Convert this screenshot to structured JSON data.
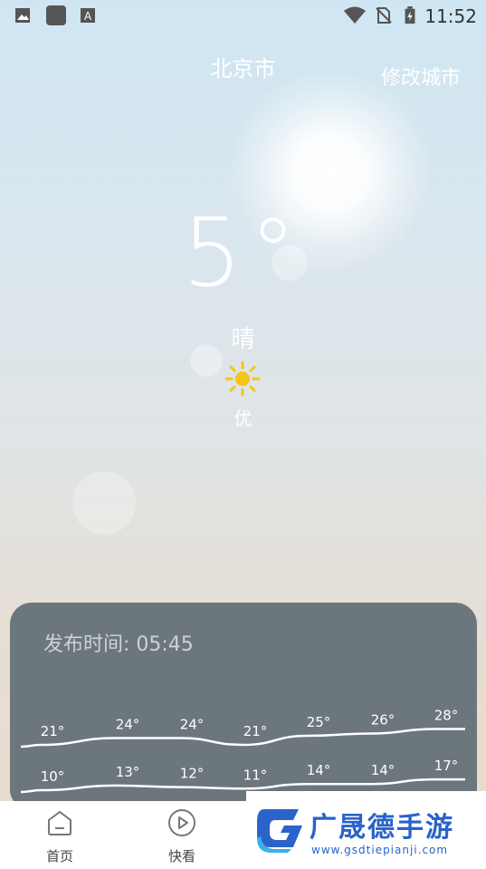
{
  "status_bar": {
    "time": "11:52",
    "icons": [
      "gallery-notification-icon",
      "app-notification-icon",
      "font-notification-icon",
      "wifi-icon",
      "no-sim-icon",
      "battery-charging-icon"
    ]
  },
  "header": {
    "city": "北京市",
    "change_city_label": "修改城市"
  },
  "current": {
    "temperature": "5°",
    "condition": "晴",
    "condition_icon": "sun-icon",
    "air_quality": "优"
  },
  "forecast": {
    "publish_time": "发布时间: 05:45",
    "chart_data": {
      "type": "line",
      "series": [
        {
          "values": [
            21,
            24,
            24,
            21,
            25,
            26,
            28
          ]
        },
        {
          "values": [
            10,
            13,
            12,
            11,
            14,
            14,
            17
          ]
        }
      ],
      "high_labels": [
        "21°",
        "24°",
        "24°",
        "21°",
        "25°",
        "26°",
        "28°"
      ],
      "low_labels": [
        "10°",
        "13°",
        "12°",
        "11°",
        "14°",
        "14°",
        "17°"
      ]
    }
  },
  "bottom_nav": {
    "items": [
      {
        "label": "首页",
        "icon": "home-icon"
      },
      {
        "label": "快看",
        "icon": "play-icon"
      }
    ]
  },
  "watermark": {
    "text": "广晟德手游",
    "url": "www.gsdtiepianji.com"
  },
  "colors": {
    "panel": "#6c767d",
    "sun": "#f5c518",
    "watermark_blue": "#2a63c9"
  }
}
